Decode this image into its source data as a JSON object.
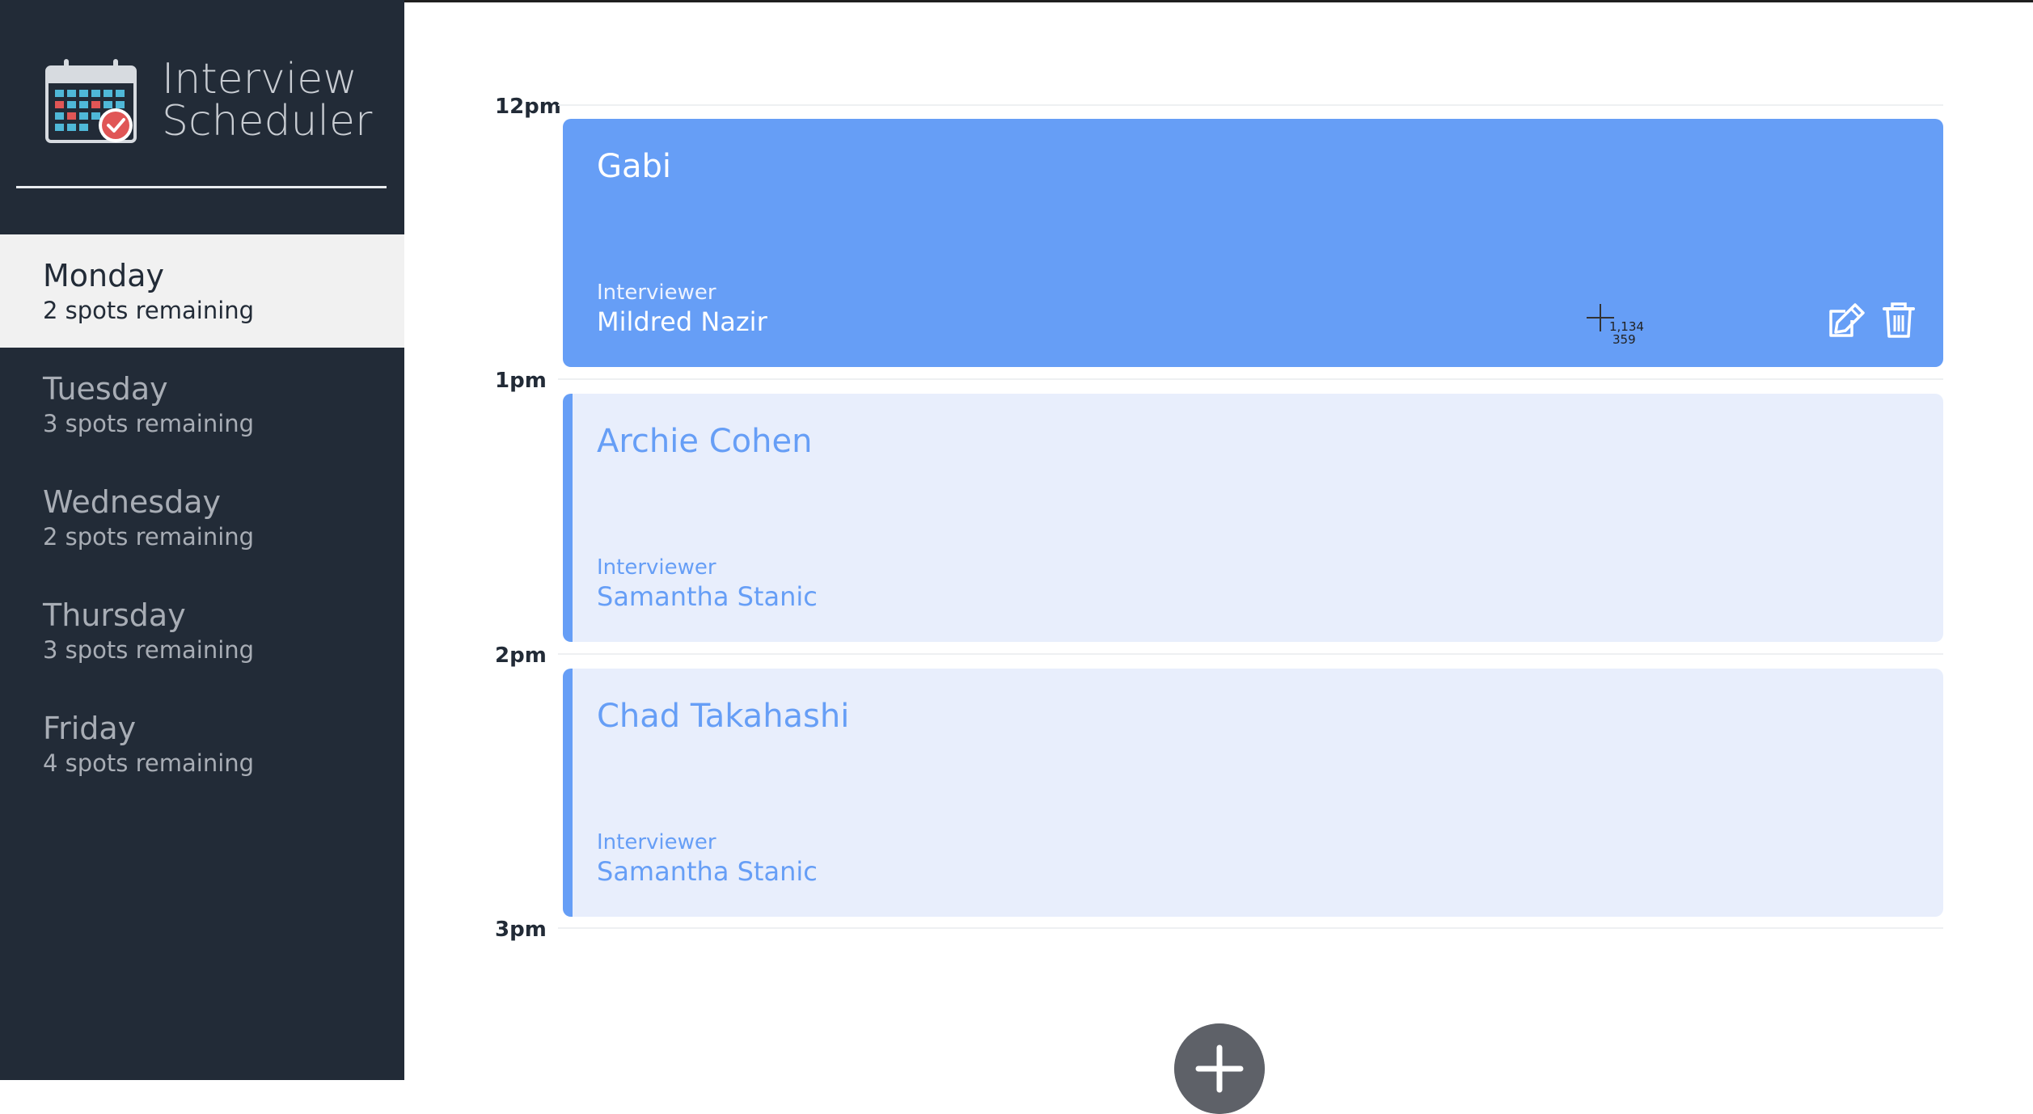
{
  "app": {
    "title_line1": "Interview",
    "title_line2": "Scheduler"
  },
  "sidebar": {
    "days": [
      {
        "name": "Monday",
        "spots": "2 spots remaining",
        "selected": true
      },
      {
        "name": "Tuesday",
        "spots": "3 spots remaining",
        "selected": false
      },
      {
        "name": "Wednesday",
        "spots": "2 spots remaining",
        "selected": false
      },
      {
        "name": "Thursday",
        "spots": "3 spots remaining",
        "selected": false
      },
      {
        "name": "Friday",
        "spots": "4 spots remaining",
        "selected": false
      }
    ]
  },
  "schedule": {
    "times": [
      "12pm",
      "1pm",
      "2pm",
      "3pm"
    ],
    "appointments": [
      {
        "student": "Gabi",
        "interviewer_label": "Interviewer",
        "interviewer": "Mildred Nazir",
        "state": "hovered"
      },
      {
        "student": "Archie Cohen",
        "interviewer_label": "Interviewer",
        "interviewer": "Samantha Stanic",
        "state": "normal"
      },
      {
        "student": "Chad Takahashi",
        "interviewer_label": "Interviewer",
        "interviewer": "Samantha Stanic",
        "state": "normal"
      }
    ]
  },
  "cursor": {
    "readout_x": "1,134",
    "readout_y": "359"
  },
  "colors": {
    "sidebar_bg": "#222b37",
    "accent": "#669ef6",
    "slot_bg": "#e8eefc",
    "selected_day_bg": "#f1f1f1",
    "add_button": "#5e6168"
  },
  "icons": [
    "calendar-logo-icon",
    "edit-icon",
    "trash-icon",
    "plus-icon",
    "crosshair-cursor-icon"
  ]
}
